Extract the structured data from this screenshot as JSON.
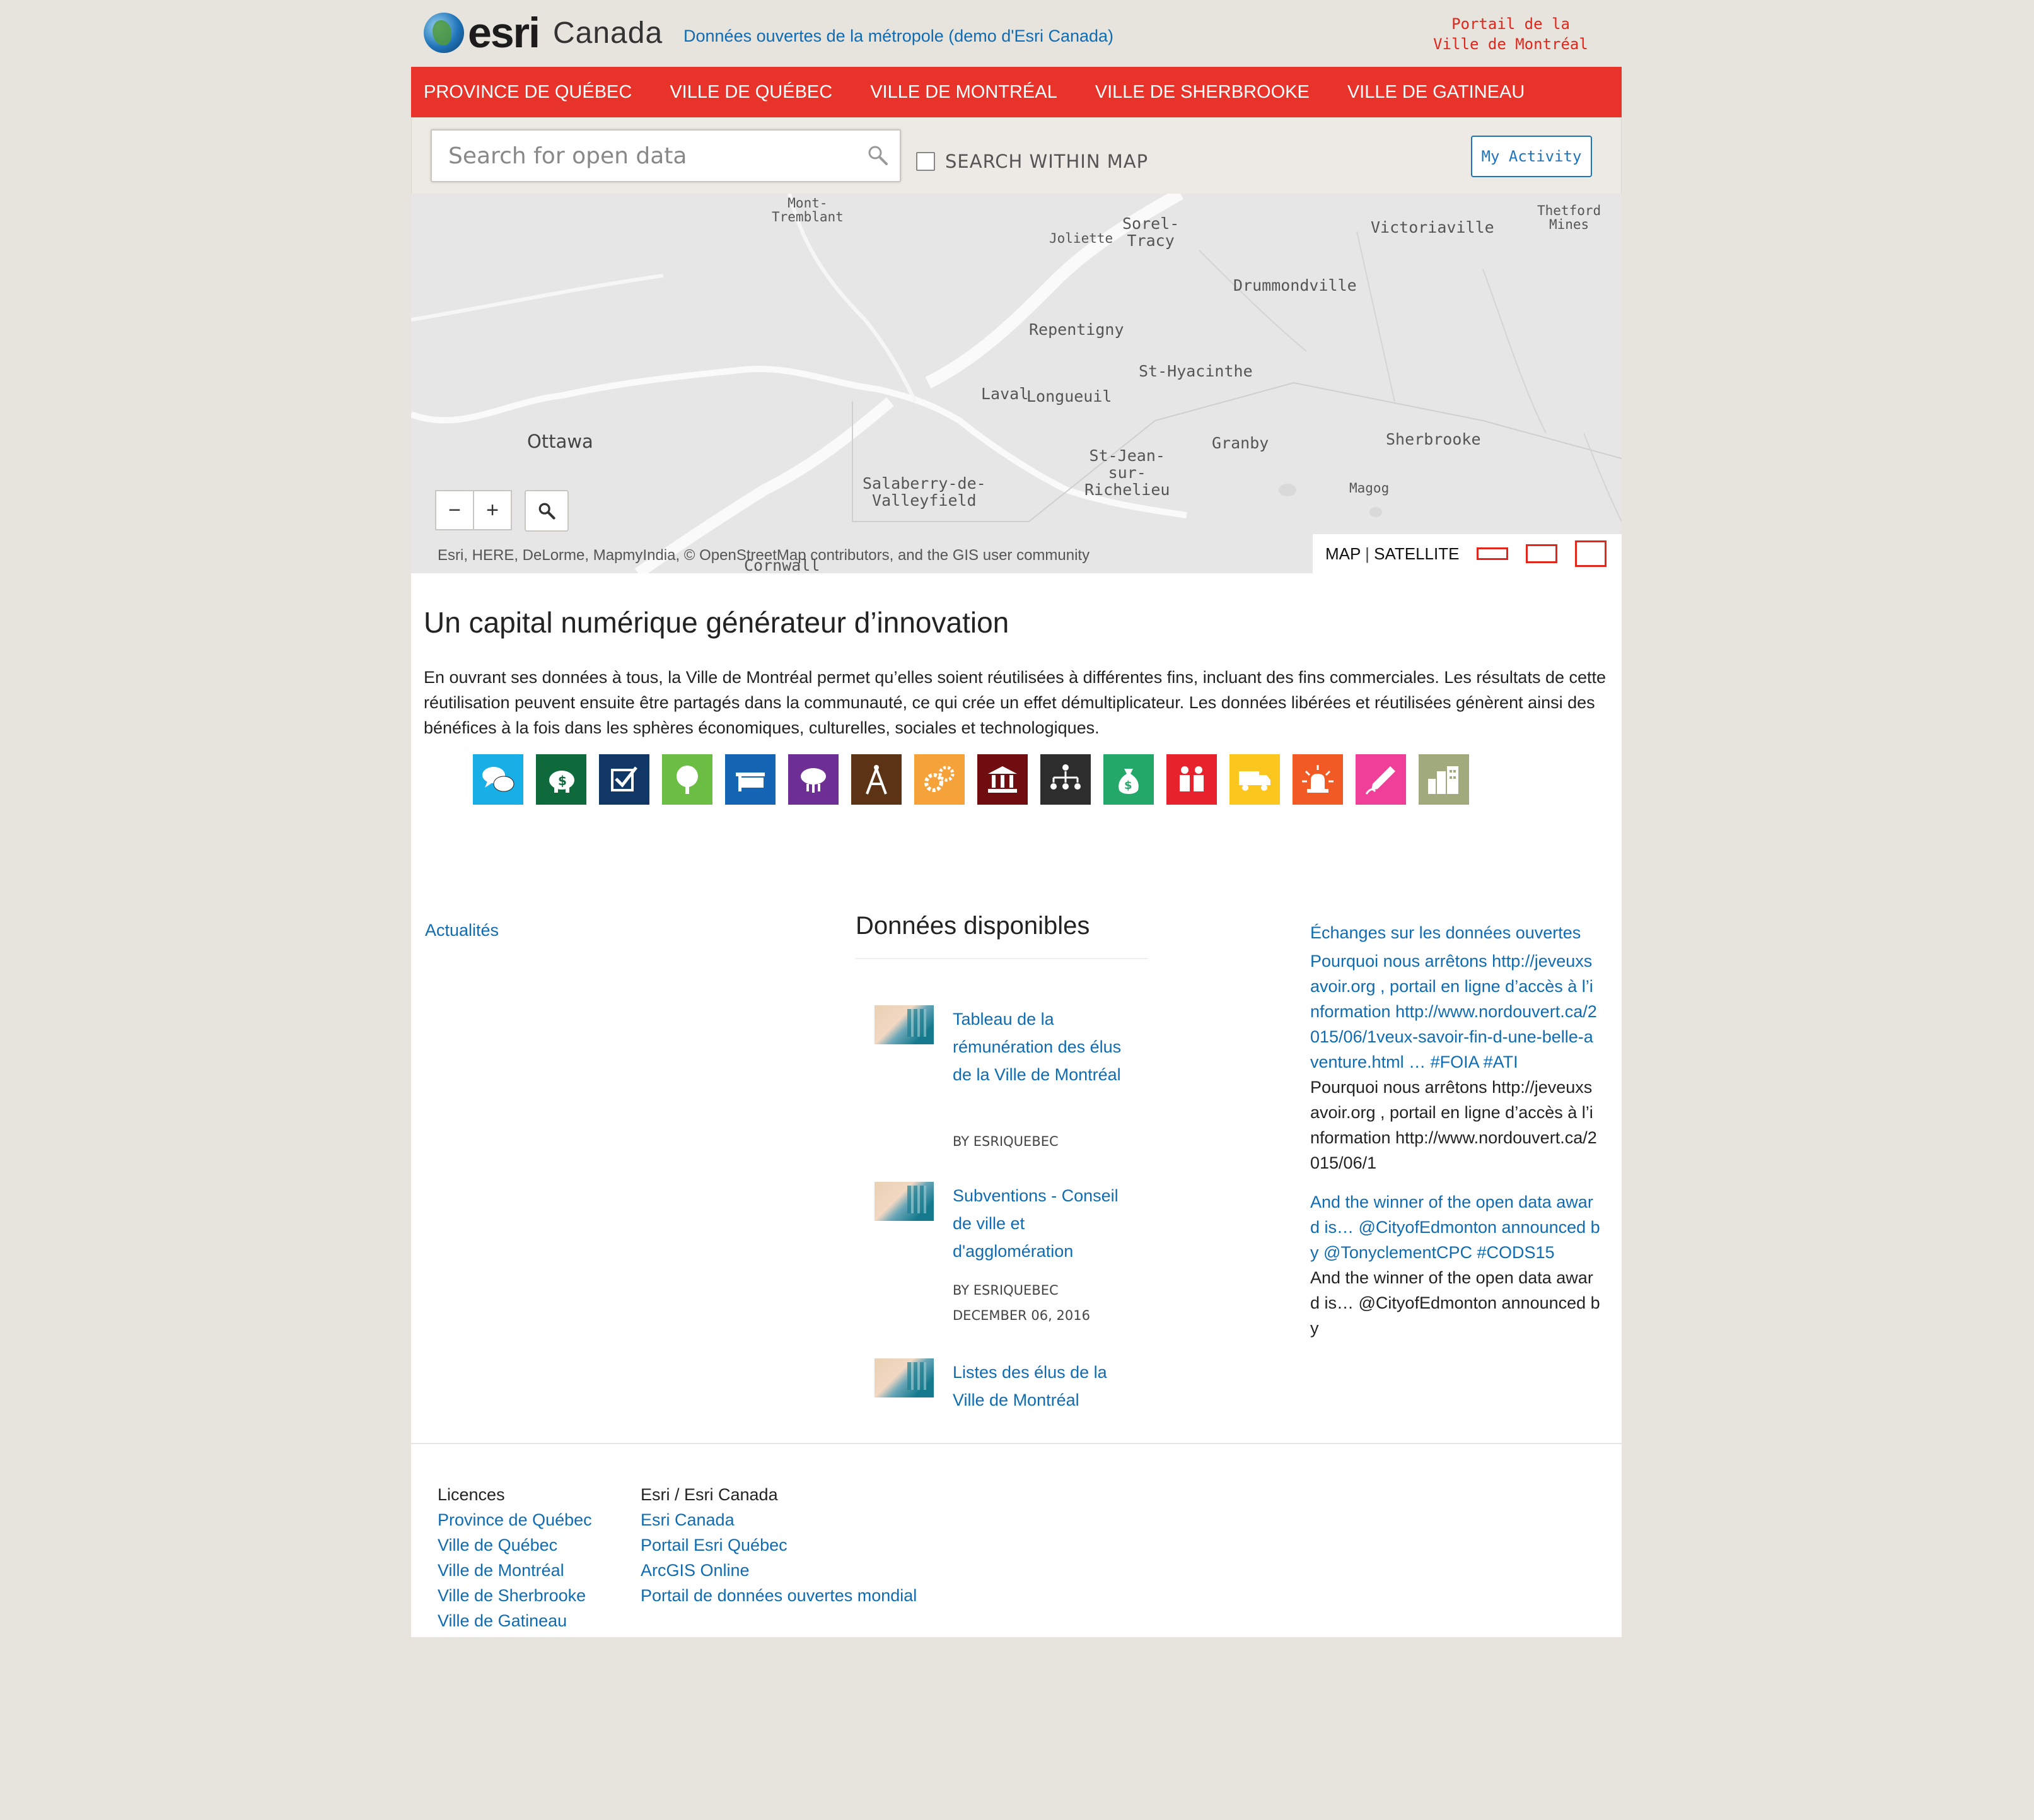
{
  "header": {
    "logo_brand": "esri",
    "logo_country": "Canada",
    "site_title": "Données ouvertes de la métropole (demo d'Esri Canada)",
    "portal_line1": "Portail de la",
    "portal_line2": "Ville de Montréal"
  },
  "nav": {
    "items": [
      "PROVINCE DE QUÉBEC",
      "VILLE DE QUÉBEC",
      "VILLE DE MONTRÉAL",
      "VILLE DE SHERBROOKE",
      "VILLE DE GATINEAU"
    ]
  },
  "search": {
    "placeholder": "Search for open data",
    "within_map_label": "SEARCH WITHIN MAP",
    "within_map_checked": false,
    "activity_button": "My Activity"
  },
  "map": {
    "cities": {
      "mont_tremblant_1": "Mont-",
      "mont_tremblant_2": "Tremblant",
      "joliette": "Joliette",
      "sorel_1": "Sorel-",
      "sorel_2": "Tracy",
      "victoriaville": "Victoriaville",
      "thetford_1": "Thetford",
      "thetford_2": "Mines",
      "drummondville": "Drummondville",
      "repentigny": "Repentigny",
      "st_hyacinthe": "St-Hyacinthe",
      "laval": "Laval",
      "longueuil": "Longueuil",
      "ottawa": "Ottawa",
      "st_jean_1": "St-Jean-",
      "st_jean_2": "sur-",
      "st_jean_3": "Richelieu",
      "granby": "Granby",
      "sherbrooke": "Sherbrooke",
      "salaberry_1": "Salaberry-de-",
      "salaberry_2": "Valleyfield",
      "magog": "Magog",
      "cornwall": "Cornwall"
    },
    "zoom_out": "−",
    "zoom_in": "+",
    "attribution": "Esri, HERE, DeLorme, MapmyIndia, © OpenStreetMap contributors, and the GIS user community",
    "basemap_map": "MAP",
    "basemap_sep": "|",
    "basemap_satellite": "SATELLITE"
  },
  "intro": {
    "title": "Un capital numérique générateur d’innovation",
    "body": "En ouvrant ses données à tous, la Ville de Montréal permet qu’elles soient réutilisées à différentes fins, incluant des fins commerciales. Les résultats de cette réutilisation peuvent ensuite être partagés dans la communauté, ce qui crée un effet démultiplicateur. Les données libérées et réutilisées génèrent ainsi des bénéfices à la fois dans les sphères économiques, culturelles, sociales et technologiques."
  },
  "categories": [
    {
      "icon": "speech-bubbles-icon",
      "color": "#18aee6"
    },
    {
      "icon": "piggy-bank-icon",
      "color": "#0e6a3b"
    },
    {
      "icon": "checkbox-icon",
      "color": "#103766"
    },
    {
      "icon": "tree-icon",
      "color": "#6cbd44"
    },
    {
      "icon": "sign-icon",
      "color": "#1565b5"
    },
    {
      "icon": "cloud-upload-icon",
      "color": "#6d2f93"
    },
    {
      "icon": "compass-icon",
      "color": "#5c3314"
    },
    {
      "icon": "gears-icon",
      "color": "#f5a23a"
    },
    {
      "icon": "institution-icon",
      "color": "#6f0d11"
    },
    {
      "icon": "org-chart-icon",
      "color": "#2d2d2d"
    },
    {
      "icon": "money-bag-icon",
      "color": "#24a86a"
    },
    {
      "icon": "people-icon",
      "color": "#e8222c"
    },
    {
      "icon": "truck-icon",
      "color": "#fbc61d"
    },
    {
      "icon": "alert-light-icon",
      "color": "#f15a24"
    },
    {
      "icon": "pen-nib-icon",
      "color": "#ef3f98"
    },
    {
      "icon": "buildings-icon",
      "color": "#a0aa7c"
    }
  ],
  "news": {
    "label": "Actualités"
  },
  "datasets": {
    "heading": "Données disponibles",
    "items": [
      {
        "title": "Tableau de la rémunération des élus de la Ville de Montréal",
        "author": "BY ESRIQUEBEC",
        "date": ""
      },
      {
        "title": "Subventions - Conseil de ville et d'agglomération",
        "author": "BY ESRIQUEBEC",
        "date": "DECEMBER 06, 2016"
      },
      {
        "title": "Listes des élus de la Ville de Montréal",
        "author": "",
        "date": ""
      }
    ]
  },
  "twitter": {
    "heading": "Échanges sur les données ouvertes",
    "t1_blue": "Pourquoi nous arrêtons http://jeveuxsavoir.org , portail en ligne d’accès à l’information http://www.nordouvert.ca/2015/06/1veux-savoir-fin-d-une-belle-aventure.html … #FOIA #ATI",
    "t1_dark": "Pourquoi nous arrêtons http://jeveuxsavoir.org , portail en ligne d’accès à l’information http://www.nordouvert.ca/2015/06/1",
    "t2_blue": "And the winner of the open data award is… @CityofEdmonton announced by @TonyclementCPC #CODS15",
    "t2_dark": "And the winner of the open data award is… @CityofEdmonton announced by"
  },
  "footer": {
    "col1_heading": "Licences",
    "col1_links": [
      "Province de Québec",
      "Ville de Québec",
      "Ville de Montréal",
      "Ville de Sherbrooke",
      "Ville de Gatineau"
    ],
    "col2_heading": "Esri / Esri Canada",
    "col2_links": [
      "Esri Canada",
      "Portail Esri Québec",
      "ArcGIS Online",
      "Portail de données ouvertes mondial"
    ]
  },
  "colors": {
    "nav_red": "#e8332a",
    "link_blue": "#0f6cb3",
    "portal_red": "#e1261c",
    "background": "#e7e3dd"
  }
}
